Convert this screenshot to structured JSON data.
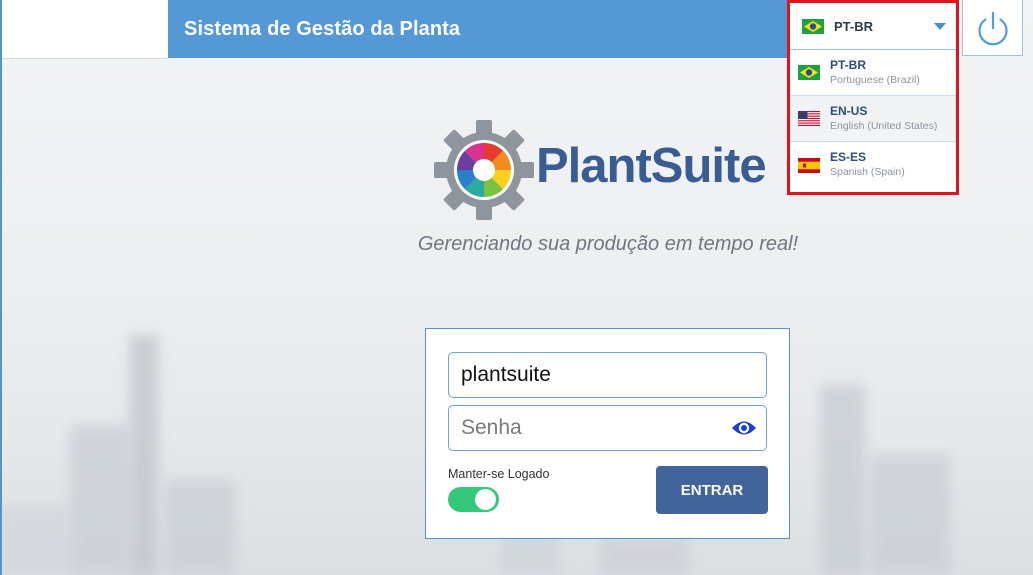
{
  "header": {
    "title": "Sistema de Gestão da Planta"
  },
  "language": {
    "current": {
      "code": "PT-BR",
      "flag": "brazil-flag-icon"
    },
    "options": [
      {
        "code": "PT-BR",
        "name": "Portuguese (Brazil)",
        "flag": "brazil-flag-icon"
      },
      {
        "code": "EN-US",
        "name": "English (United States)",
        "flag": "usa-flag-icon"
      },
      {
        "code": "ES-ES",
        "name": "Spanish (Spain)",
        "flag": "spain-flag-icon"
      }
    ]
  },
  "power": {
    "icon": "power-icon"
  },
  "brand": {
    "name": "PlantSuite",
    "slogan": "Gerenciando sua produção em tempo real!"
  },
  "login": {
    "username_value": "plantsuite",
    "password_placeholder": "Senha",
    "remember_label": "Manter-se Logado",
    "remember_checked": true,
    "submit_label": "ENTRAR"
  },
  "colors": {
    "header": "#5499d6",
    "brand_text": "#395d93",
    "button": "#41659a",
    "toggle_on": "#34c97a",
    "highlight_border": "#e0141e"
  }
}
